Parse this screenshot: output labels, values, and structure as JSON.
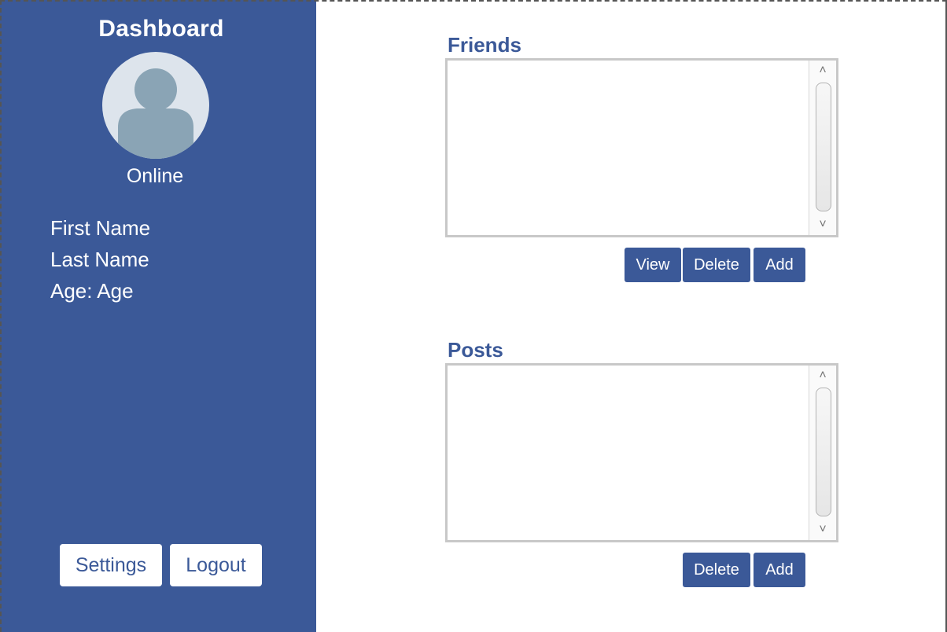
{
  "sidebar": {
    "title": "Dashboard",
    "status": "Online",
    "first_name": "First Name",
    "last_name": "Last Name",
    "age": "Age: Age",
    "settings_label": "Settings",
    "logout_label": "Logout"
  },
  "friends": {
    "title": "Friends",
    "view_label": "View",
    "delete_label": "Delete",
    "add_label": "Add"
  },
  "posts": {
    "title": "Posts",
    "delete_label": "Delete",
    "add_label": "Add"
  },
  "icons": {
    "avatar": "user-silhouette-icon",
    "scroll_up": "chevron-up-icon",
    "scroll_down": "chevron-down-icon"
  },
  "colors": {
    "brand": "#3b5998",
    "panel_bg": "#ffffff"
  }
}
